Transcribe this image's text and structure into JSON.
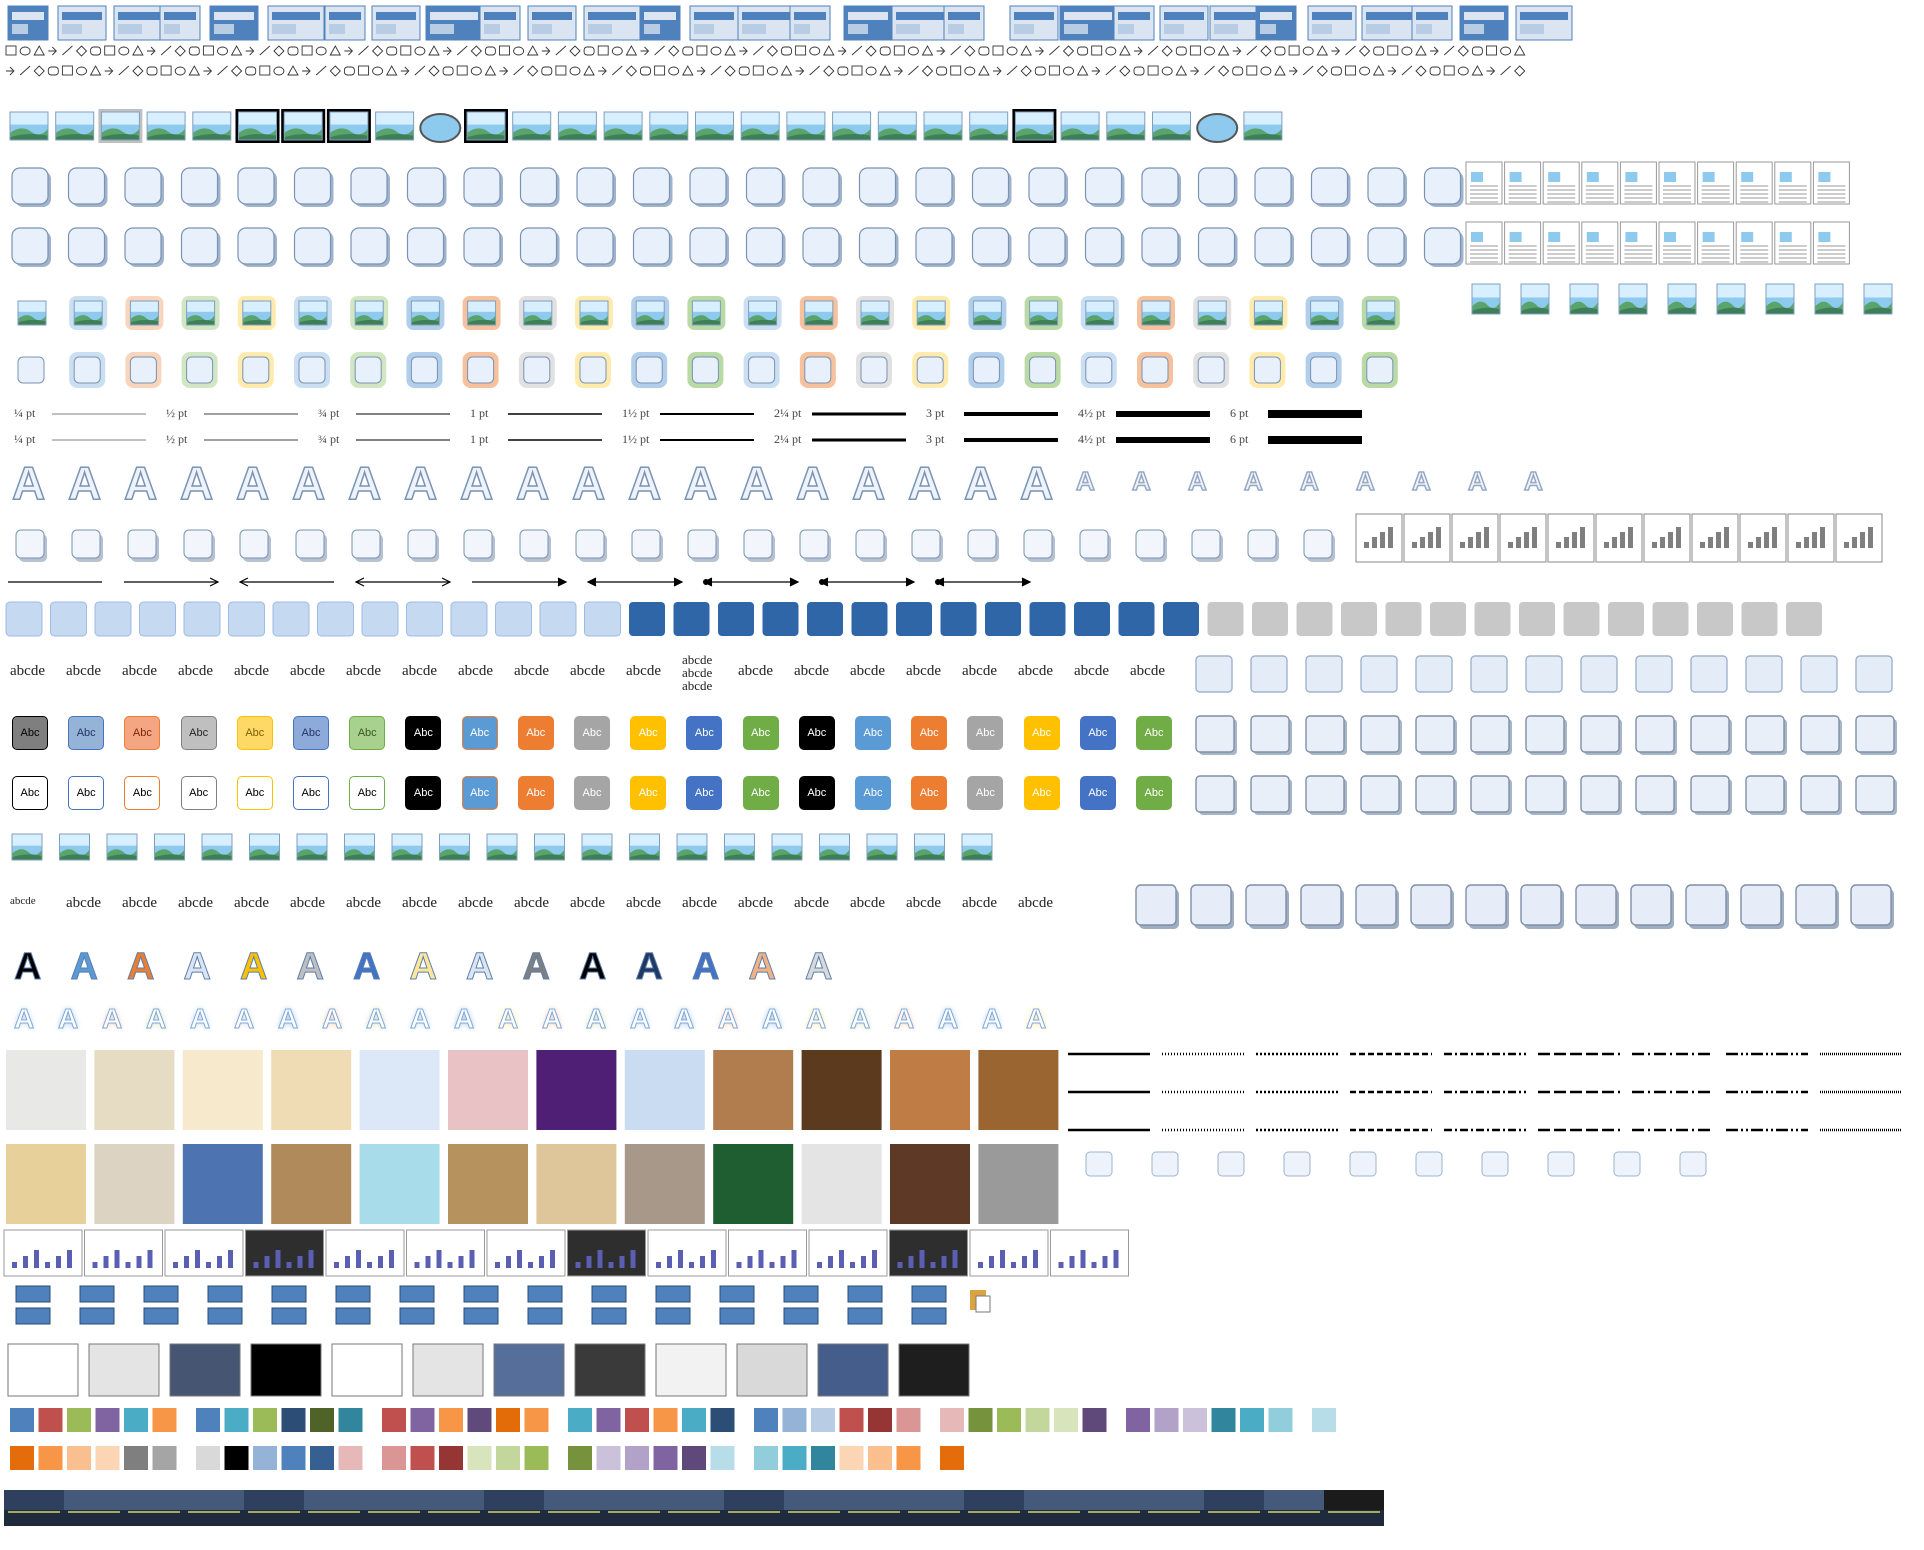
{
  "line_weights": {
    "labels": [
      "¼ pt",
      "½ pt",
      "¾ pt",
      "1 pt",
      "1½ pt",
      "2¼ pt",
      "3 pt",
      "4½ pt",
      "6 pt"
    ],
    "widths": [
      0.5,
      0.75,
      1,
      1.5,
      2,
      3,
      4,
      6,
      8
    ]
  },
  "word_art_sample": "abcde",
  "word_art_stack": [
    "abcde",
    "abcde",
    "abcde"
  ],
  "abc_label": "Abc",
  "letter_A": "A",
  "colors": {
    "accent": "#4f81bd",
    "abc_fills": [
      "#7f7f7f",
      "#95b3d7",
      "#f4a582",
      "#bfbfbf",
      "#ffd966",
      "#8eaadb",
      "#a9d18e",
      "#000000",
      "#5b9bd5",
      "#ed7d31",
      "#a5a5a5",
      "#ffc000",
      "#4472c4",
      "#70ad47",
      "#000000",
      "#5b9bd5",
      "#ed7d31",
      "#a5a5a5",
      "#ffc000",
      "#4472c4",
      "#70ad47"
    ],
    "abc_text": [
      "#000000",
      "#1f3864",
      "#7f2704",
      "#262626",
      "#7f6000",
      "#1f3864",
      "#385723",
      "#ffffff",
      "#ffffff",
      "#ffffff",
      "#ffffff",
      "#ffffff",
      "#ffffff",
      "#ffffff",
      "#ffffff",
      "#ffffff",
      "#ffffff",
      "#ffffff",
      "#ffffff",
      "#ffffff",
      "#ffffff"
    ],
    "abc_outlines": [
      "#000000",
      "#4472c4",
      "#ed7d31",
      "#7f7f7f",
      "#ffc000",
      "#4472c4",
      "#70ad47",
      "#000000",
      "#ed7d31",
      "#ed7d31",
      "#a5a5a5",
      "#ffc000",
      "#4472c4",
      "#70ad47",
      "#000000",
      "#5b9bd5",
      "#ed7d31",
      "#a5a5a5",
      "#ffc000",
      "#4472c4",
      "#70ad47"
    ],
    "big_A": [
      "#000000",
      "#5b9bd5",
      "#ed7d31",
      "#dbe5f1",
      "#ffc000",
      "#bfbfbf",
      "#4472c4",
      "#ffe699",
      "#dbe5f1",
      "#7f7f7f",
      "#000000",
      "#1f3864",
      "#4472c4",
      "#f4b183",
      "#d9d9d9"
    ],
    "glow_A": [
      "#bdd7ee",
      "#9dc3e6",
      "#f8cbad",
      "#c5e0b4",
      "#bdd7ee",
      "#d9d9d9",
      "#9dc3e6",
      "#f8cbad",
      "#c5e0b4",
      "#bdd7ee",
      "#9dc3e6",
      "#ffe699",
      "#f8cbad",
      "#c5e0b4",
      "#bdd7ee",
      "#9dc3e6",
      "#f8cbad",
      "#9dc3e6",
      "#ffe699",
      "#c5e0b4",
      "#f8cbad",
      "#9dc3e6",
      "#bdd7ee",
      "#ffe699"
    ],
    "textures": [
      "#e8e8e6",
      "#e6dcc4",
      "#f6e9cc",
      "#efdcb4",
      "#dce8f8",
      "#e9c2c6",
      "#4e1f74",
      "#c9dcf1",
      "#b27d4e",
      "#5c3a1e",
      "#c07c45",
      "#9a6530",
      "#e7d09a",
      "#ddd3c2",
      "#4d74b0",
      "#b08a5a",
      "#a8dcea",
      "#b6935e",
      "#dfc59a",
      "#a8988a",
      "#1f5e30",
      "#e4e4e4",
      "#5e3a26",
      "#9a9a9a"
    ],
    "solid_fills": [
      "#ffffff",
      "#e4e4e4",
      "#455572",
      "#000000",
      "#ffffff",
      "#e4e4e4",
      "#566f9a",
      "#3a3a3a",
      "#f2f2f2",
      "#d9d9d9",
      "#445d8a",
      "#1e1e1e"
    ],
    "palette_rows": [
      [
        "#4f81bd",
        "#c0504d",
        "#9bbb59",
        "#8064a2",
        "#4bacc6",
        "#f79646",
        "#4f81bd",
        "#4bacc6",
        "#9bbb59",
        "#2c4d75",
        "#4f6228",
        "#31859c",
        "#c0504d",
        "#8064a2",
        "#f79646",
        "#604a7b",
        "#e36c09",
        "#f79646",
        "#4bacc6",
        "#8064a2",
        "#c0504d",
        "#f79646",
        "#4bacc6",
        "#2c4d75",
        "#4f81bd",
        "#95b3d7",
        "#b8cce4",
        "#c0504d",
        "#963634",
        "#da9694",
        "#e6b9b8",
        "#76923c",
        "#9bbb59",
        "#c3d69b",
        "#d7e4bc",
        "#5f497a",
        "#8064a2",
        "#b3a2c7",
        "#ccc1da",
        "#31859c",
        "#4bacc6",
        "#92cddc",
        "#b7dee8"
      ],
      [
        "#e46c0a",
        "#f79646",
        "#fabf8f",
        "#fcd5b4",
        "#7f7f7f",
        "#a5a5a5",
        "#d9d9d9",
        "#000000",
        "#95b3d7",
        "#4f81bd",
        "#366092",
        "#e6b9b8",
        "#da9694",
        "#c0504d",
        "#963634",
        "#d7e4bc",
        "#c3d69b",
        "#9bbb59",
        "#76923c",
        "#ccc1da",
        "#b3a2c7",
        "#8064a2",
        "#5f497a",
        "#b7dee8",
        "#92cddc",
        "#4bacc6",
        "#31859c",
        "#fcd5b4",
        "#fabf8f",
        "#f79646",
        "#e46c0a"
      ]
    ]
  },
  "dash_styles": 9
}
